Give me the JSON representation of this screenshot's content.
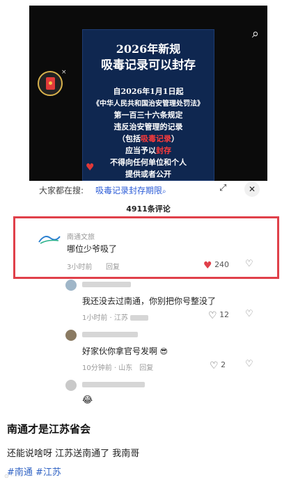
{
  "poster": {
    "title_line1": "2026年新规",
    "title_line2": "吸毒记录可以封存",
    "lines": [
      "自2026年1月1日起",
      "《中华人民共和国治安管理处罚法》",
      "第一百三十六条规定",
      "违反治安管理的记录",
      "应当予以封存",
      "不得向任何单位和个人",
      "提供或者公开"
    ],
    "line5_pre": "（包括",
    "line5_red": "吸毒记录",
    "line5_post": "）",
    "line6_pre": "应当予以",
    "line6_red": "封存"
  },
  "search": {
    "prefix": "大家都在搜:",
    "term": "吸毒记录封存期限",
    "term_icon": "search-icon"
  },
  "comments_count": "4911条评论",
  "comments": [
    {
      "author": "南通文旅",
      "text": "哪位少爷吸了",
      "time": "3小时前",
      "reply": "回复",
      "likes": "240",
      "liked": true
    },
    {
      "author": "",
      "text": "我还没去过南通，你别把你号整没了",
      "time": "1小时前",
      "location": "江苏",
      "reply": "",
      "likes": "12"
    },
    {
      "author": "",
      "text": "好家伙你拿官号发啊",
      "time": "10分钟前",
      "location": "山东",
      "reply": "回复",
      "likes": "2"
    },
    {
      "author": "",
      "text": "",
      "time": "",
      "likes": ""
    }
  ],
  "caption": {
    "title": "南通才是江苏省会",
    "text": "还能说啥呀 江苏送南通了 我南哥",
    "tags": "#南通 #江苏"
  },
  "colors": {
    "accent_red": "#e0404a",
    "link_blue": "#2a5bd7",
    "tag_blue": "#2f62c4",
    "poster_bg": "#0f2750"
  }
}
